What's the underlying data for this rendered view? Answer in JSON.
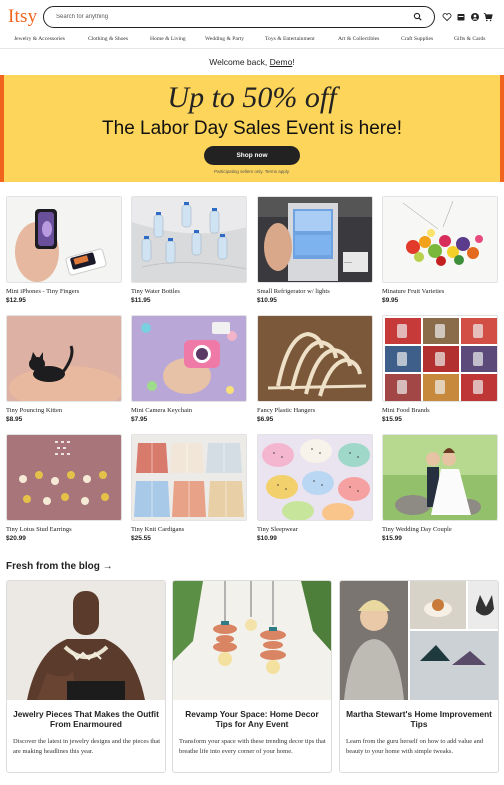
{
  "header": {
    "logo": "Itsy",
    "search_placeholder": "Search for anything",
    "icons": [
      "search-icon",
      "heart-icon",
      "store-icon",
      "account-icon",
      "cart-icon"
    ]
  },
  "categories": [
    "Jewelry & Accessories",
    "Clothing & Shoes",
    "Home & Living",
    "Wedding & Party",
    "Toys & Entertainment",
    "Art & Collectibles",
    "Craft Supplies",
    "Gifts & Cards"
  ],
  "welcome": {
    "text": "Welcome back,",
    "user": "Demo",
    "suffix": "!"
  },
  "banner": {
    "headline": "Up to 50% off",
    "subheadline": "The Labor Day Sales Event is here!",
    "button": "Shop now",
    "fine_print": "Participating sellers only. Terms apply.",
    "color_bg": "#fdd55a",
    "color_edge": "#f1641e"
  },
  "products": [
    {
      "name": "Mini iPhones - Tiny Fingers",
      "price": "$12.95"
    },
    {
      "name": "Tiny Water Bottles",
      "price": "$11.95"
    },
    {
      "name": "Small Refrigerator w/ lights",
      "price": "$10.95"
    },
    {
      "name": "Minature Fruit Varieties",
      "price": "$9.95"
    },
    {
      "name": "Tiny Pouncing Kitten",
      "price": "$8.95"
    },
    {
      "name": "Mini Camera Keychain",
      "price": "$7.95"
    },
    {
      "name": "Fancy Plastic Hangers",
      "price": "$6.95"
    },
    {
      "name": "Mini Food Brands",
      "price": "$15.95"
    },
    {
      "name": "Tiny Lotus Stud Earrings",
      "price": "$20.99"
    },
    {
      "name": "Tiny Knit Cardigans",
      "price": "$25.55"
    },
    {
      "name": "Tiny Sleepwear",
      "price": "$10.99"
    },
    {
      "name": "Tiny Wedding Day Couple",
      "price": "$15.99"
    }
  ],
  "blog": {
    "heading": "Fresh from the blog →",
    "posts": [
      {
        "title": "Jewelry Pieces That Makes the Outfit From Enarmoured",
        "description": "Discover the latest in jewelry designs and the pieces that are making headlines this year."
      },
      {
        "title": "Revamp Your Space: Home Decor Tips for Any Event",
        "description": "Transform your space with these trending decor tips that breathe life into every corner of your home."
      },
      {
        "title": "Martha Stewart's Home Improvement Tips",
        "description": "Learn from the guru herself on how to add value and beauty to your home with simple tweaks."
      }
    ]
  }
}
